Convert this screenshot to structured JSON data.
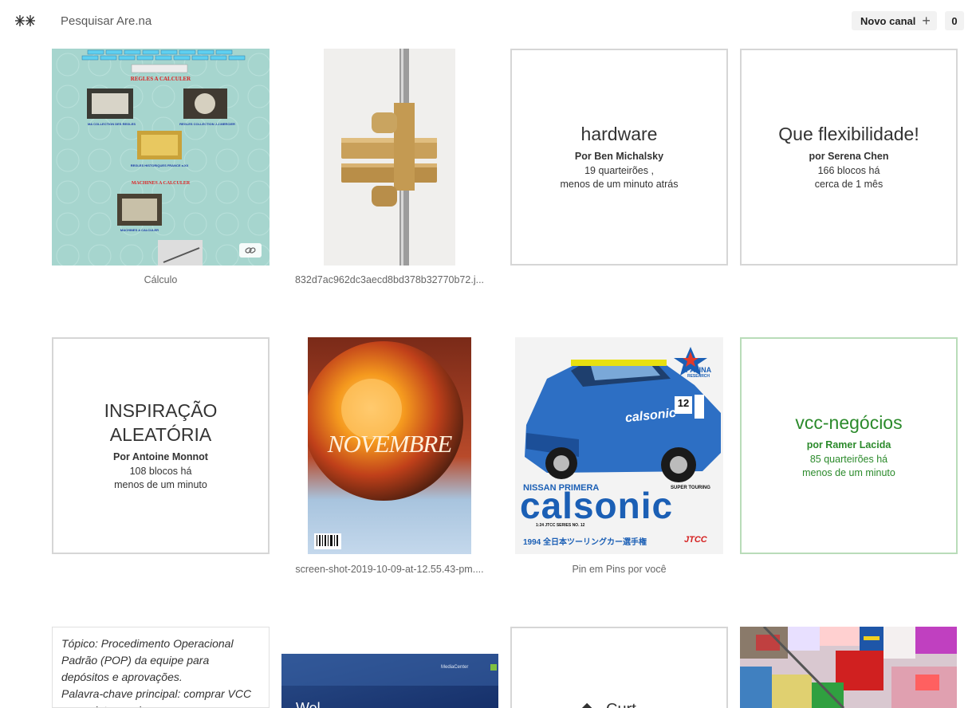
{
  "header": {
    "search_placeholder": "Pesquisar Are.na",
    "new_channel_label": "Novo canal",
    "count": "0"
  },
  "blocks": {
    "calculo": {
      "caption": "Cálculo",
      "page_title": "REGLES A CALCULER",
      "item1": "MA COLLECTION DES REGLES",
      "item2": "REGLES COLLECTION J.J.MERCIER",
      "item3": "REGLES HISTORIQUES FRANCE a.XX",
      "section2": "MACHINES A CALCULER",
      "item4": "MACHINES A CALCULER"
    },
    "clamp": {
      "caption": "832d7ac962dc3aecd8bd378b32770b72.j..."
    },
    "hardware": {
      "title": "hardware",
      "author": "Por Ben Michalsky",
      "meta1": "19 quarteirões ,",
      "meta2": "menos de um minuto atrás"
    },
    "flex": {
      "title": "Que flexibilidade!",
      "author": "por Serena Chen",
      "meta1": "166 blocos há",
      "meta2": "cerca de 1 mês"
    },
    "inspiracao": {
      "title1": "INSPIRAÇÃO",
      "title2": "ALEATÓRIA",
      "author": "Por Antoine Monnot",
      "meta1": "108 blocos há",
      "meta2": "menos de um minuto"
    },
    "novembre": {
      "caption": "screen-shot-2019-10-09-at-12.55.43-pm....",
      "cover_text": "NOVEMBRE"
    },
    "calsonic": {
      "caption": "Pin em Pins por você",
      "brand": "PATINA",
      "brand_sub": "RESEARCH",
      "model": "NISSAN PRIMERA",
      "logo": "calsonic",
      "subtitle": "SUPER TOURING",
      "series": "1:24 JTCC SERIES NO. 12",
      "year": "1994 全日本ツーリングカー選手権",
      "jtcc": "JTCC",
      "car_number": "12"
    },
    "vcc": {
      "title": "vcc-negócios",
      "author": "por Ramer Lacida",
      "meta1": "85 quarteirões há",
      "meta2": "menos de um minuto"
    },
    "topico": {
      "text": "Tópico: Procedimento Operacional Padrão (POP) da equipe para depósitos e aprovações.",
      "text2": "Palavra-chave principal: comprar VCC com criptomoedas"
    },
    "mediacenter": {
      "brand": "MediaCenter",
      "welcome": "Wel"
    },
    "channel_bottom": {
      "title": "Curt"
    }
  },
  "colors": {
    "accent_green": "#2b8a2b",
    "channel_border": "#d6d6d6"
  }
}
